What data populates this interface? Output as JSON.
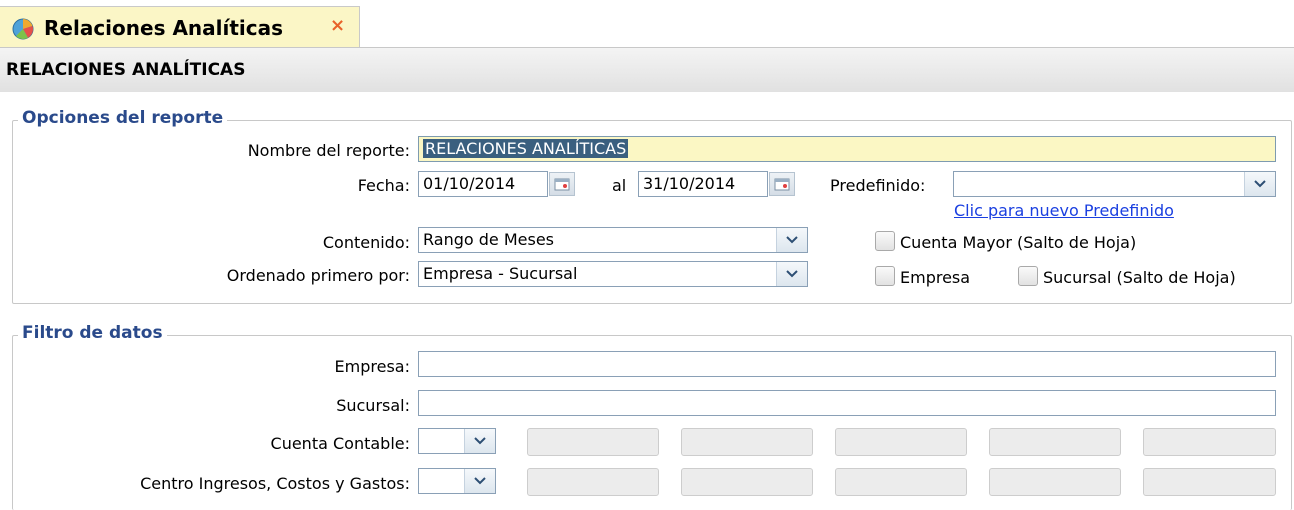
{
  "tab": {
    "title": "Relaciones Analíticas",
    "close_glyph": "×",
    "icon": "pie-chart-icon"
  },
  "page_title": "RELACIONES ANALÍTICAS",
  "opciones": {
    "legend": "Opciones del reporte",
    "nombre_label": "Nombre del reporte:",
    "nombre_value": "RELACIONES ANALÍTICAS",
    "fecha_label": "Fecha:",
    "fecha_desde": "01/10/2014",
    "al_label": "al",
    "fecha_hasta": "31/10/2014",
    "predefinido_label": "Predefinido:",
    "predefinido_value": "",
    "nuevo_predefinido_link": "Clic para nuevo Predefinido",
    "contenido_label": "Contenido:",
    "contenido_value": "Rango de Meses",
    "ordenado_label": "Ordenado primero por:",
    "ordenado_value": "Empresa - Sucursal",
    "chk_cuenta_mayor": "Cuenta Mayor (Salto de Hoja)",
    "chk_empresa": "Empresa",
    "chk_sucursal": "Sucursal (Salto de Hoja)"
  },
  "filtro": {
    "legend": "Filtro de datos",
    "empresa_label": "Empresa:",
    "empresa_value": "",
    "sucursal_label": "Sucursal:",
    "sucursal_value": "",
    "cuenta_label": "Cuenta Contable:",
    "centro_label": "Centro Ingresos, Costos y Gastos:"
  },
  "colors": {
    "legend": "#2a4a8b",
    "tab_bg": "#fbf6c6",
    "highlight": "#fbf7c4",
    "link": "#1a3fe0",
    "close": "#e8622a"
  }
}
